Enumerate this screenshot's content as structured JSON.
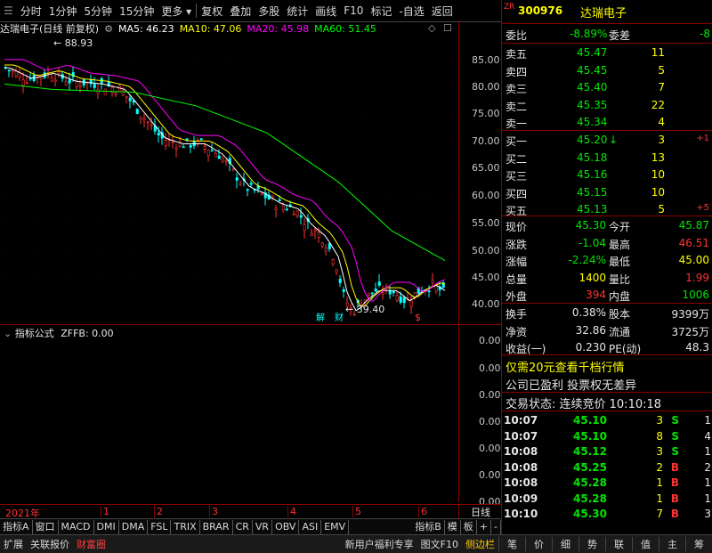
{
  "toolbar": {
    "items": [
      "分时",
      "1分钟",
      "5分钟",
      "15分钟",
      "更多",
      "复权",
      "叠加",
      "多股",
      "统计",
      "画线",
      "F10",
      "标记",
      "-自选",
      "返回"
    ]
  },
  "chart": {
    "title": "达瑞电子(日线 前复权)",
    "ma5": "MA5: 46.23",
    "ma10": "MA10: 47.06",
    "ma20": "MA20: 45.98",
    "ma60": "MA60: 51.45",
    "high_label": "88.93",
    "low_label": "39.40",
    "y_ticks": [
      "85.00",
      "80.00",
      "75.00",
      "70.00",
      "65.00",
      "60.00",
      "55.00",
      "50.00",
      "45.00",
      "40.00"
    ],
    "markers": [
      "解",
      "财",
      "$"
    ],
    "colors": {
      "ma5": "#ffffff",
      "ma10": "#ffff00",
      "ma20": "#ff00ff",
      "ma60": "#00ff00",
      "up": "#ff3232",
      "down": "#00ffff"
    }
  },
  "indicator": {
    "title": "指标公式",
    "value": "ZFFB: 0.00",
    "y_ticks": [
      "0.00",
      "0.00",
      "0.00",
      "0.00",
      "0.00",
      "0.00",
      "0.00"
    ]
  },
  "timeline": {
    "labels": [
      "2021年",
      "1",
      "2",
      "3",
      "4",
      "5",
      "6"
    ],
    "right_label": "日线"
  },
  "tabs": [
    "指标A",
    "窗口",
    "MACD",
    "DMI",
    "DMA",
    "FSL",
    "TRIX",
    "BRAR",
    "CR",
    "VR",
    "OBV",
    "ASI",
    "EMV"
  ],
  "tabs_right": [
    "指标B",
    "模",
    "板",
    "+",
    "-"
  ],
  "status": {
    "left": [
      "扩展",
      "关联报价",
      "财富圈"
    ],
    "mid": [
      "新用户福利专享",
      "图文F10",
      "侧边栏"
    ],
    "right": [
      "笔",
      "价",
      "细",
      "势",
      "联",
      "值",
      "主",
      "筹"
    ]
  },
  "quote": {
    "code": "300976",
    "name": "达瑞电子",
    "tag": "ZR",
    "weibi_label": "委比",
    "weibi": "-8.89%",
    "weicha_label": "委差",
    "weicha": "-8",
    "sell": [
      {
        "label": "卖五",
        "price": "45.47",
        "vol": "11"
      },
      {
        "label": "卖四",
        "price": "45.45",
        "vol": "5"
      },
      {
        "label": "卖三",
        "price": "45.40",
        "vol": "7"
      },
      {
        "label": "卖二",
        "price": "45.35",
        "vol": "22"
      },
      {
        "label": "卖一",
        "price": "45.34",
        "vol": "4"
      }
    ],
    "buy": [
      {
        "label": "买一",
        "price": "45.20",
        "vol": "3",
        "chg": "+1",
        "arrow": "↓"
      },
      {
        "label": "买二",
        "price": "45.18",
        "vol": "13",
        "chg": "",
        "arrow": ""
      },
      {
        "label": "买三",
        "price": "45.16",
        "vol": "10",
        "chg": "",
        "arrow": ""
      },
      {
        "label": "买四",
        "price": "45.15",
        "vol": "10",
        "chg": "",
        "arrow": ""
      },
      {
        "label": "买五",
        "price": "45.13",
        "vol": "5",
        "chg": "+5",
        "arrow": ""
      }
    ],
    "stats": [
      {
        "l1": "现价",
        "v1": "45.30",
        "l2": "今开",
        "v2": "45.87"
      },
      {
        "l1": "涨跌",
        "v1": "-1.04",
        "l2": "最高",
        "v2": "46.51"
      },
      {
        "l1": "涨幅",
        "v1": "-2.24%",
        "l2": "最低",
        "v2": "45.00"
      },
      {
        "l1": "总量",
        "v1": "1400",
        "l2": "量比",
        "v2": "1.99"
      },
      {
        "l1": "外盘",
        "v1": "394",
        "l2": "内盘",
        "v2": "1006"
      }
    ],
    "stats2": [
      {
        "l1": "换手",
        "v1": "0.38%",
        "l2": "股本",
        "v2": "9399万"
      },
      {
        "l1": "净资",
        "v1": "32.86",
        "l2": "流通",
        "v2": "3725万"
      },
      {
        "l1": "收益(一)",
        "v1": "0.230",
        "l2": "PE(动)",
        "v2": "48.3"
      }
    ],
    "promo": "仅需20元查看千档行情",
    "promo2": "公司已盈利 投票权无差异",
    "trade_state": "交易状态: 连续竞价 10:10:18",
    "ticks": [
      {
        "t": "10:07",
        "p": "45.10",
        "v": "3",
        "bs": "S",
        "n": "1"
      },
      {
        "t": "10:07",
        "p": "45.10",
        "v": "8",
        "bs": "S",
        "n": "4"
      },
      {
        "t": "10:08",
        "p": "45.12",
        "v": "3",
        "bs": "S",
        "n": "1"
      },
      {
        "t": "10:08",
        "p": "45.25",
        "v": "2",
        "bs": "B",
        "n": "2"
      },
      {
        "t": "10:08",
        "p": "45.28",
        "v": "1",
        "bs": "B",
        "n": "1"
      },
      {
        "t": "10:09",
        "p": "45.28",
        "v": "1",
        "bs": "B",
        "n": "1"
      },
      {
        "t": "10:10",
        "p": "45.30",
        "v": "7",
        "bs": "B",
        "n": "3"
      }
    ]
  }
}
